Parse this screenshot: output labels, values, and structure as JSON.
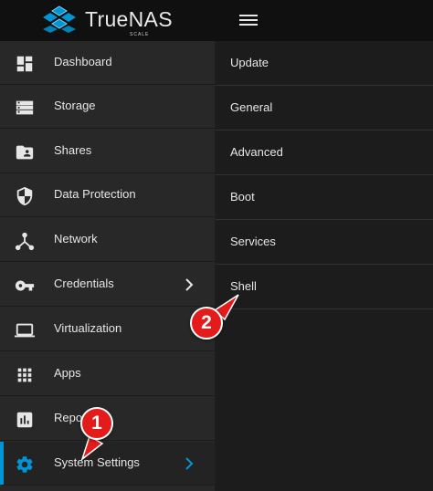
{
  "app": {
    "logo_text": "TrueNAS",
    "logo_sub": "SCALE",
    "menu_icon": "hamburger-menu-icon",
    "accent_color": "#0095d5"
  },
  "sidebar": {
    "items": [
      {
        "label": "Dashboard",
        "icon": "dashboard-icon"
      },
      {
        "label": "Storage",
        "icon": "storage-icon"
      },
      {
        "label": "Shares",
        "icon": "shares-folder-icon"
      },
      {
        "label": "Data Protection",
        "icon": "shield-icon"
      },
      {
        "label": "Network",
        "icon": "network-icon"
      },
      {
        "label": "Credentials",
        "icon": "key-icon",
        "has_submenu": true
      },
      {
        "label": "Virtualization",
        "icon": "laptop-icon"
      },
      {
        "label": "Apps",
        "icon": "apps-grid-icon"
      },
      {
        "label": "Repo",
        "icon": "reports-chart-icon"
      },
      {
        "label": "System Settings",
        "icon": "gear-icon",
        "has_submenu": true,
        "active": true
      }
    ]
  },
  "submenu": {
    "items": [
      {
        "label": "Update"
      },
      {
        "label": "General"
      },
      {
        "label": "Advanced"
      },
      {
        "label": "Boot"
      },
      {
        "label": "Services"
      },
      {
        "label": "Shell"
      }
    ]
  },
  "markers": [
    {
      "label": "1",
      "color": "#e31b1b"
    },
    {
      "label": "2",
      "color": "#e31b1b"
    }
  ]
}
